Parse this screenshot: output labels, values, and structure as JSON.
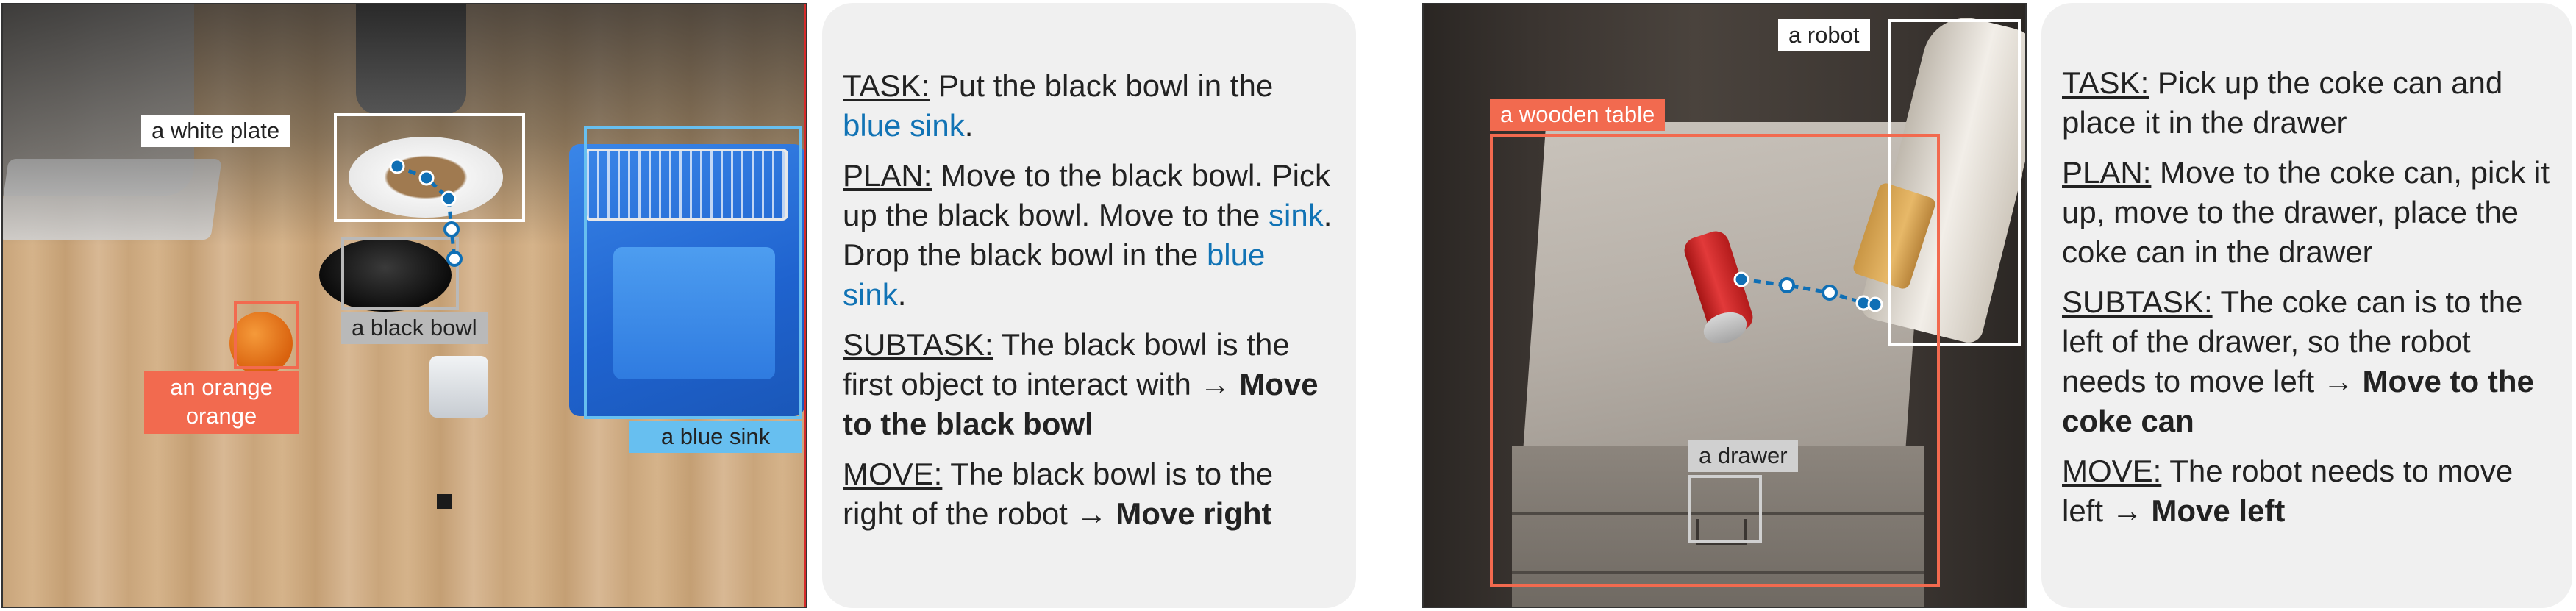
{
  "example1": {
    "scene_labels": {
      "white_plate": "a white plate",
      "black_bowl": "a black bowl",
      "orange": "an orange\norange",
      "blue_sink": "a blue sink"
    },
    "task": {
      "label": "TASK:",
      "text_a": " Put the black bowl in the ",
      "hl": "blue sink",
      "text_b": "."
    },
    "plan": {
      "label": "PLAN:",
      "text_a": " Move to the black bowl. Pick up the black bowl. Move to the ",
      "hl1": "sink",
      "text_b": ". Drop the black bowl in the ",
      "hl2": "blue sink",
      "text_c": "."
    },
    "subtask": {
      "label": "SUBTASK:",
      "text": " The black bowl is the first object to interact with → ",
      "bold": "Move to the black bowl"
    },
    "move": {
      "label": "MOVE:",
      "text": " The black bowl is to the right of the robot → ",
      "bold": "Move right"
    }
  },
  "example2": {
    "scene_labels": {
      "robot": "a robot",
      "wooden_table": "a wooden table",
      "drawer": "a drawer"
    },
    "task": {
      "label": "TASK:",
      "text": " Pick up the coke can and place it in the drawer"
    },
    "plan": {
      "label": "PLAN:",
      "text": " Move to the coke can, pick it up, move to the drawer, place the coke can in the drawer"
    },
    "subtask": {
      "label": "SUBTASK:",
      "text": " The coke can is to the left of the drawer, so the robot needs to move left → ",
      "bold": "Move to the coke can"
    },
    "move": {
      "label": "MOVE:",
      "text": " The robot needs to move left → ",
      "bold": "Move left"
    }
  },
  "colors": {
    "trajectory": "#0f6fb5",
    "plate_box": "#ffffff",
    "bowl_box": "#b9b9b9",
    "orange_box": "#f26a4f",
    "sink_box": "#67bff0",
    "table_box": "#f26a4f",
    "robot_box": "#ffffff",
    "drawer_box": "#d0d0d0"
  }
}
